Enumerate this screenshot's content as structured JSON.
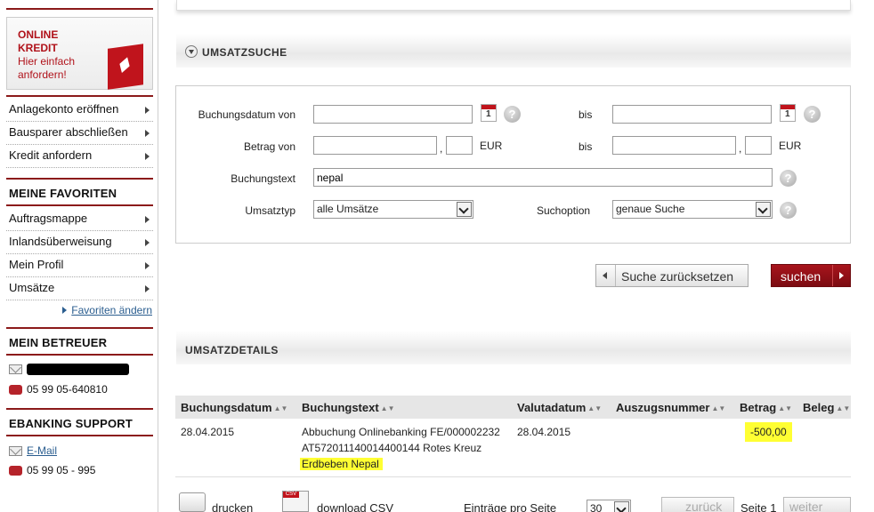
{
  "sidebar": {
    "promo": {
      "line1": "ONLINE",
      "line2": "KREDIT",
      "line3": "Hier einfach",
      "line4": "anfordern!"
    },
    "links": [
      "Anlagekonto eröffnen",
      "Bausparer abschließen",
      "Kredit anfordern"
    ],
    "favorites_title": "MEINE FAVORITEN",
    "favorites": [
      "Auftragsmappe",
      "Inlandsüberweisung",
      "Mein Profil",
      "Umsätze"
    ],
    "favorites_edit": "Favoriten ändern",
    "advisor_title": "MEIN BETREUER",
    "advisor_phone": "05 99 05-640810",
    "support_title": "EBANKING SUPPORT",
    "support_email": "E-Mail",
    "support_phone": "05 99 05 - 995"
  },
  "search": {
    "title": "UMSATZSUCHE",
    "date_from_label": "Buchungsdatum von",
    "bis": "bis",
    "amount_from_label": "Betrag von",
    "currency": "EUR",
    "comma": ",",
    "text_label": "Buchungstext",
    "text_value": "nepal",
    "type_label": "Umsatztyp",
    "type_value": "alle Umsätze",
    "option_label": "Suchoption",
    "option_value": "genaue Suche",
    "calendar_day": "1",
    "help": "?",
    "reset_button": "Suche zurücksetzen",
    "search_button": "suchen"
  },
  "details": {
    "title": "UMSATZDETAILS",
    "columns": [
      "Buchungsdatum",
      "Buchungstext",
      "Valutadatum",
      "Auszugsnummer",
      "Betrag",
      "Beleg"
    ],
    "sort_glyph": "▲▼",
    "rows": [
      {
        "date": "28.04.2015",
        "text_line1": "Abbuchung Onlinebanking FE/000002232",
        "text_line2": "AT572011140014400144 Rotes Kreuz",
        "text_line3": "Erdbeben Nepal",
        "valuta": "28.04.2015",
        "amount": "-500,00"
      }
    ]
  },
  "footer": {
    "print": "drucken",
    "csv": "download CSV",
    "per_page_label": "Einträge pro Seite",
    "per_page_value": "30",
    "prev": "zurück",
    "page": "Seite 1",
    "next": "weiter"
  }
}
